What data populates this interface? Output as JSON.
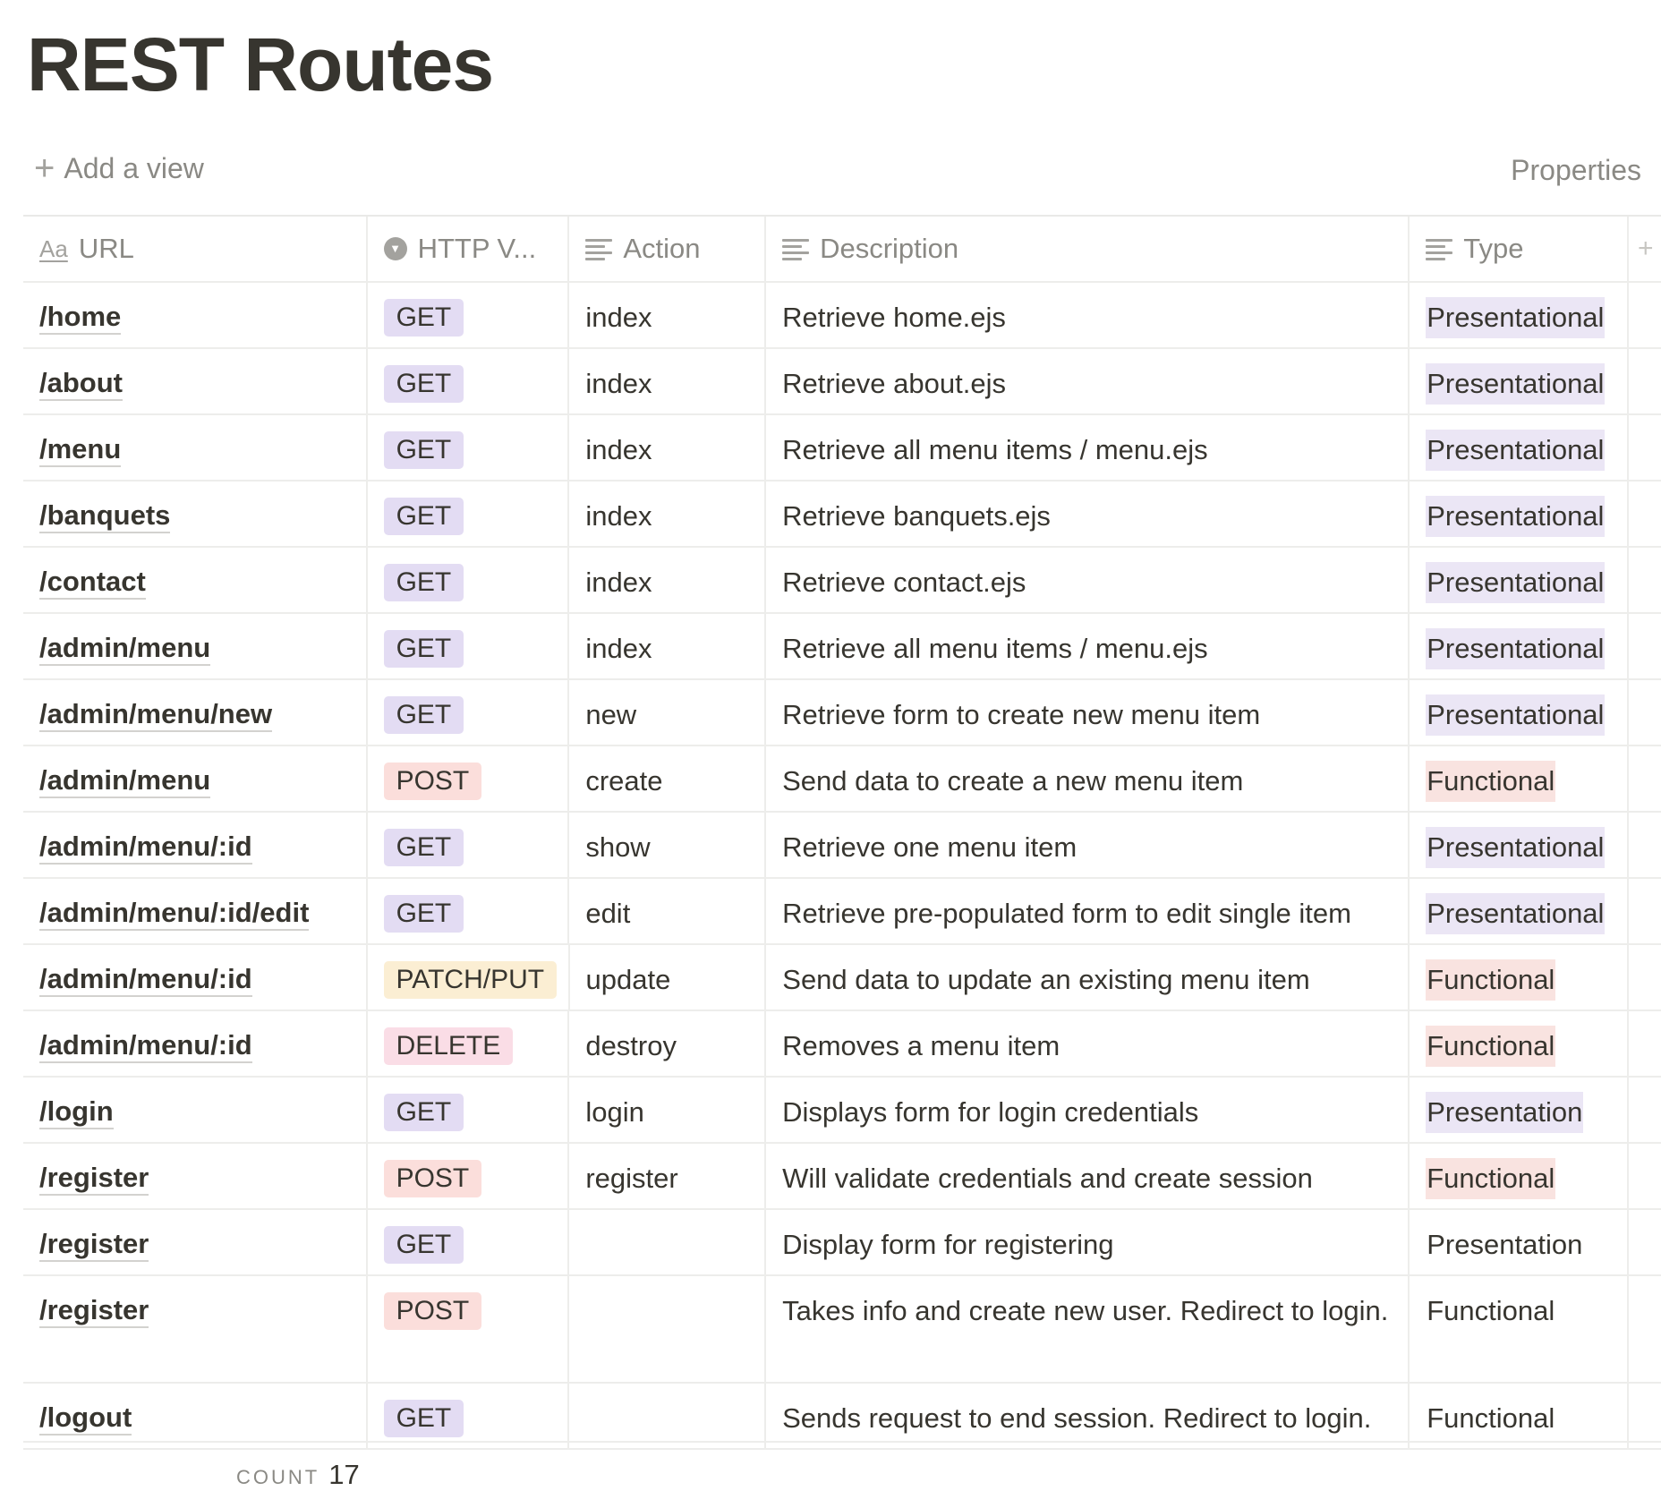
{
  "page": {
    "title": "REST Routes"
  },
  "toolbar": {
    "add_view_label": "Add a view",
    "properties_label": "Properties"
  },
  "columns": {
    "url": "URL",
    "verb": "HTTP V...",
    "action": "Action",
    "description": "Description",
    "type": "Type"
  },
  "rows": [
    {
      "url": "/home",
      "verb": "GET",
      "action": "index",
      "description": "Retrieve home.ejs",
      "type": "Presentational"
    },
    {
      "url": "/about",
      "verb": "GET",
      "action": "index",
      "description": "Retrieve about.ejs",
      "type": "Presentational"
    },
    {
      "url": "/menu",
      "verb": "GET",
      "action": "index",
      "description": "Retrieve all menu items / menu.ejs",
      "type": "Presentational"
    },
    {
      "url": "/banquets",
      "verb": "GET",
      "action": "index",
      "description": "Retrieve banquets.ejs",
      "type": "Presentational"
    },
    {
      "url": "/contact",
      "verb": "GET",
      "action": "index",
      "description": "Retrieve contact.ejs",
      "type": "Presentational"
    },
    {
      "url": "/admin/menu",
      "verb": "GET",
      "action": "index",
      "description": "Retrieve all menu items / menu.ejs",
      "type": "Presentational"
    },
    {
      "url": "/admin/menu/new",
      "verb": "GET",
      "action": "new",
      "description": "Retrieve form to create new menu item",
      "type": "Presentational"
    },
    {
      "url": "/admin/menu",
      "verb": "POST",
      "action": "create",
      "description": "Send data to create a new menu item",
      "type": "Functional"
    },
    {
      "url": "/admin/menu/:id",
      "verb": "GET",
      "action": "show",
      "description": "Retrieve one menu item",
      "type": "Presentational"
    },
    {
      "url": "/admin/menu/:id/edit",
      "verb": "GET",
      "action": "edit",
      "description": "Retrieve pre-populated form to edit single item",
      "type": "Presentational"
    },
    {
      "url": "/admin/menu/:id",
      "verb": "PATCH/PUT",
      "action": "update",
      "description": "Send data to update an existing menu item",
      "type": "Functional"
    },
    {
      "url": "/admin/menu/:id",
      "verb": "DELETE",
      "action": "destroy",
      "description": "Removes a menu item",
      "type": "Functional"
    },
    {
      "url": "/login",
      "verb": "GET",
      "action": "login",
      "description": "Displays form for login credentials",
      "type": "Presentation"
    },
    {
      "url": "/register",
      "verb": "POST",
      "action": "register",
      "description": "Will validate credentials and create session",
      "type": "Functional"
    },
    {
      "url": "/register",
      "verb": "GET",
      "action": "",
      "description": "Display form for registering",
      "type": "Presentation"
    },
    {
      "url": "/register",
      "verb": "POST",
      "action": "",
      "description": "Takes info and create new user. Redirect to login.",
      "type": "Functional"
    },
    {
      "url": "/logout",
      "verb": "GET",
      "action": "",
      "description": "Sends request to end session. Redirect to login.",
      "type": "Functional"
    }
  ],
  "footer": {
    "count_label": "COUNT",
    "count_value": "17"
  },
  "colors": {
    "get": "#e3dcf3",
    "post": "#fbdedb",
    "patch": "#fbeed3",
    "delete": "#fadde6",
    "presentational": "#ebe6f5",
    "functional": "#f9e3e0",
    "text": "#37352f",
    "muted": "#8a8984"
  },
  "icons": {
    "url_column": "text-aa-icon",
    "verb_column": "select-icon",
    "text_column": "lines-icon",
    "add_view": "plus-icon",
    "add_column": "plus-icon"
  }
}
